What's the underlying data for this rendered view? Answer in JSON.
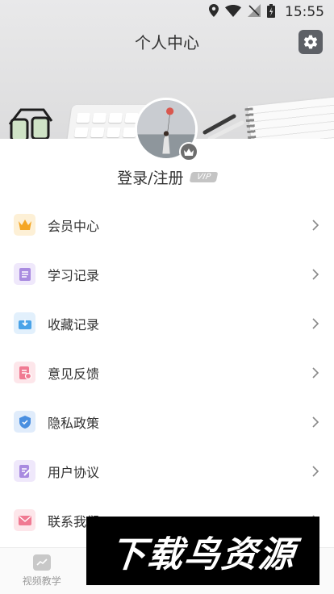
{
  "status_bar": {
    "time": "15:55"
  },
  "header": {
    "title": "个人中心"
  },
  "profile": {
    "login_label": "登录/注册",
    "vip_label": "VIP"
  },
  "menu": {
    "items": [
      {
        "label": "会员中心",
        "icon": "crown-icon",
        "color": "#f5a623"
      },
      {
        "label": "学习记录",
        "icon": "notebook-icon",
        "color": "#a98be0"
      },
      {
        "label": "收藏记录",
        "icon": "download-box-icon",
        "color": "#4aa3e8"
      },
      {
        "label": "意见反馈",
        "icon": "feedback-doc-icon",
        "color": "#f07a92"
      },
      {
        "label": "隐私政策",
        "icon": "shield-icon",
        "color": "#4a8fe0"
      },
      {
        "label": "用户协议",
        "icon": "edit-doc-icon",
        "color": "#a98be0"
      },
      {
        "label": "联系我们",
        "icon": "mail-icon",
        "color": "#f07a92"
      }
    ]
  },
  "tabbar": {
    "tabs": [
      {
        "label": "视频教学",
        "icon": "chart-icon"
      }
    ]
  },
  "watermark": {
    "text": "下载鸟资源"
  }
}
